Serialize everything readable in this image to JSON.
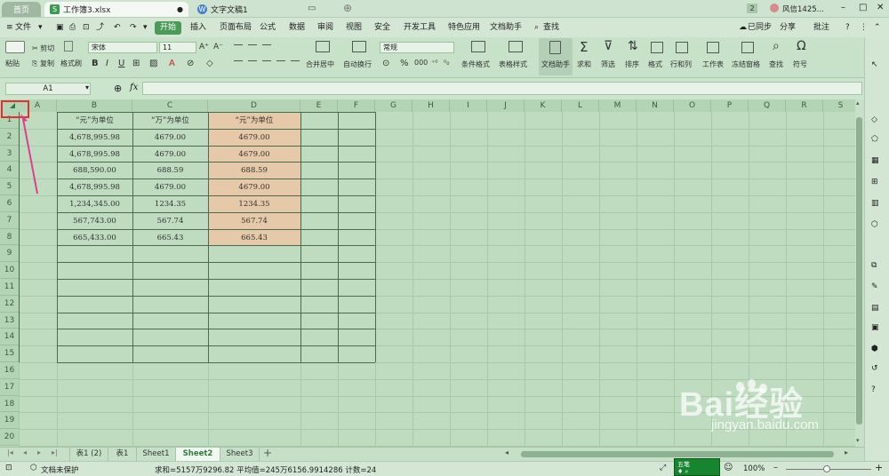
{
  "titlebar": {
    "home_tab": "首页",
    "workbook_tab": "工作簿3.xlsx",
    "doc_tab": "文字文稿1",
    "badge": "2",
    "user": "风信1425..."
  },
  "menu": {
    "file": "文件",
    "items": [
      "开始",
      "插入",
      "页面布局",
      "公式",
      "数据",
      "审阅",
      "视图",
      "安全",
      "开发工具",
      "特色应用",
      "文档助手"
    ],
    "search": "查找",
    "sync": "已同步",
    "share": "分享",
    "comment": "批注"
  },
  "ribbon": {
    "paste": "粘贴",
    "cut": "剪切",
    "copy": "复制",
    "format_painter": "格式刷",
    "font_name": "宋体",
    "font_size": "11",
    "merge": "合并居中",
    "wrap": "自动换行",
    "number_format": "常规",
    "conditional_format": "条件格式",
    "table_style": "表格样式",
    "doc_assistant": "文档助手",
    "sum": "求和",
    "filter": "筛选",
    "sort": "排序",
    "format": "格式",
    "row_col": "行和列",
    "worksheet": "工作表",
    "freeze": "冻结窗格",
    "find": "查找",
    "symbol": "符号"
  },
  "formula_bar": {
    "name_box": "A1",
    "fx": "fx",
    "content": ""
  },
  "columns": [
    "A",
    "B",
    "C",
    "D",
    "E",
    "F",
    "G",
    "H",
    "I",
    "J",
    "K",
    "L",
    "M",
    "N",
    "O",
    "P",
    "Q",
    "R",
    "S"
  ],
  "rows": [
    "1",
    "2",
    "3",
    "4",
    "5",
    "6",
    "7",
    "8",
    "9",
    "10",
    "11",
    "12",
    "13",
    "14",
    "15",
    "16",
    "17",
    "18",
    "19",
    "20"
  ],
  "table": {
    "headers": [
      "“元”为单位",
      "“万”为单位",
      "“元”为单位"
    ],
    "rows": [
      [
        "4,678,995.98",
        "4679.00",
        "4679.00"
      ],
      [
        "4,678,995.98",
        "4679.00",
        "4679.00"
      ],
      [
        "688,590.00",
        "688.59",
        "688.59"
      ],
      [
        "4,678,995.98",
        "4679.00",
        "4679.00"
      ],
      [
        "1,234,345.00",
        "1234.35",
        "1234.35"
      ],
      [
        "567,743.00",
        "567.74",
        "567.74"
      ],
      [
        "665,433.00",
        "665.43",
        "665.43"
      ]
    ],
    "highlight_color": "#e6c9a8"
  },
  "sheets": [
    "表1 (2)",
    "表1",
    "Sheet1",
    "Sheet2",
    "Sheet3"
  ],
  "active_sheet": "Sheet2",
  "status": {
    "protect": "文档未保护",
    "stats": "求和=5157万9296.82  平均值=245万6156.9914286  计数=24",
    "zoom": "100%"
  },
  "watermark": {
    "brand": "Bai经验",
    "url": "jingyan.baidu.com"
  },
  "colors": {
    "accent": "#4b9a5a",
    "annotation": "#e23c8c",
    "selection_box": "#e03030"
  }
}
